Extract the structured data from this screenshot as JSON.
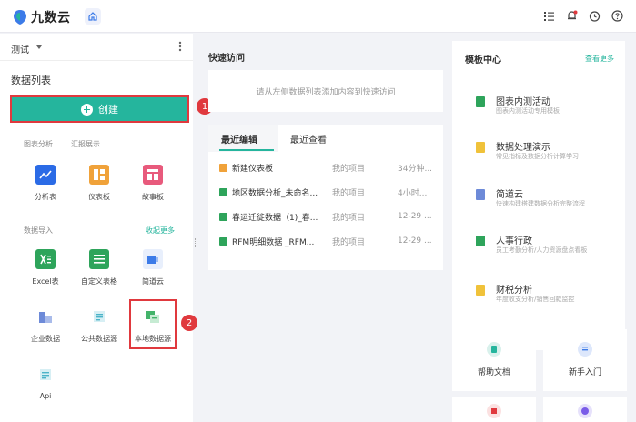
{
  "app": {
    "name": "九数云",
    "accent": "#25b59d",
    "highlight": "#e0393e"
  },
  "topbar": {
    "icons": [
      "list-icon",
      "bell-icon",
      "clock-icon",
      "help-icon"
    ]
  },
  "sidebar": {
    "project": "测试",
    "title": "数据列表",
    "create_label": "创建",
    "marker_1": "1",
    "marker_2": "2",
    "tabs": [
      "图表分析",
      "汇报展示"
    ],
    "analysis_tiles": [
      {
        "label": "分析表",
        "icon": "analysis-table-icon",
        "color": "#2b6be6"
      },
      {
        "label": "仪表板",
        "icon": "dashboard-icon",
        "color": "#f0a23a"
      },
      {
        "label": "故事板",
        "icon": "storyboard-icon",
        "color": "#e85a7c"
      }
    ],
    "import_title": "数据导入",
    "manage_label": "收起更多",
    "import_tiles": [
      {
        "label": "Excel表",
        "icon": "excel-icon",
        "color": "#2ea45b"
      },
      {
        "label": "自定义表格",
        "icon": "custom-table-icon",
        "color": "#2ea45b"
      },
      {
        "label": "简道云",
        "icon": "jiandaoyun-icon",
        "color": "#3c7be8"
      },
      {
        "label": "企业数据",
        "icon": "enterprise-data-icon",
        "color": "#6d8ad8"
      },
      {
        "label": "公共数据源",
        "icon": "public-data-icon",
        "color": "#4bb3c8"
      },
      {
        "label": "本地数据源",
        "icon": "local-data-icon",
        "color": "#43b36a"
      },
      {
        "label": "Api",
        "icon": "api-icon",
        "color": "#4bb3c8"
      }
    ]
  },
  "main": {
    "quick_title": "快速访问",
    "quick_hint": "请从左侧数据列表添加内容到快速访问",
    "tabs": [
      "最近编辑",
      "最近查看"
    ],
    "rows": [
      {
        "name": "新建仪表板",
        "project": "我的项目",
        "time": "34分钟...",
        "icon_color": "#f0a23a"
      },
      {
        "name": "地区数据分析_未命名...",
        "project": "我的项目",
        "time": "4小时...",
        "icon_color": "#2ea45b"
      },
      {
        "name": "春运迁徙数据（1)_春...",
        "project": "我的项目",
        "time": "12-29 ...",
        "icon_color": "#2ea45b"
      },
      {
        "name": "RFM明细数据 _RFM...",
        "project": "我的项目",
        "time": "12-29 ...",
        "icon_color": "#2ea45b"
      }
    ]
  },
  "templates": {
    "title": "模板中心",
    "more_label": "查看更多",
    "items": [
      {
        "name": "图表内测活动",
        "desc": "图表内测活动专用模板",
        "color": "#2ea45b"
      },
      {
        "name": "数据处理演示",
        "desc": "常见指标及数据分析计算学习",
        "color": "#f0c23a"
      },
      {
        "name": "简道云",
        "desc": "快速构建搭建数据分析完整流程",
        "color": "#6d8ad8"
      },
      {
        "name": "人事行政",
        "desc": "员工考勤分析/人力资源盘点看板",
        "color": "#2ea45b"
      },
      {
        "name": "财税分析",
        "desc": "年度收支分析/销售回款监控",
        "color": "#f0c23a"
      }
    ]
  },
  "help": {
    "docs_label": "帮助文档",
    "newbie_label": "新手入门"
  }
}
